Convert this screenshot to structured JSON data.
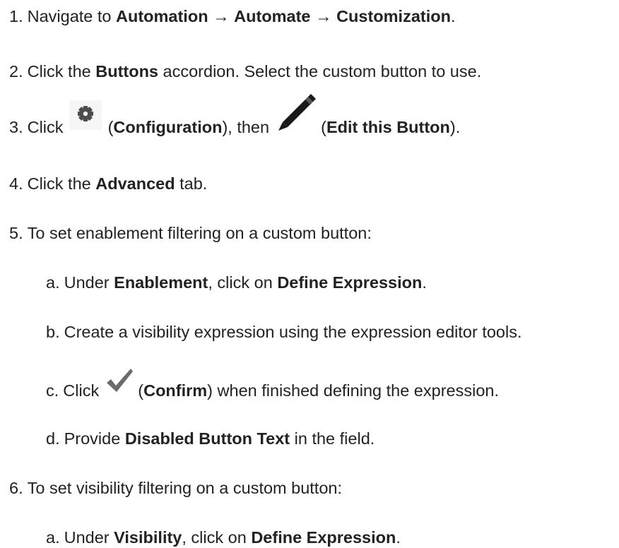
{
  "steps": [
    {
      "num": "1.",
      "t1": "Navigate to ",
      "b1": "Automation",
      "t2": " → ",
      "b2": "Automate",
      "t3": " → ",
      "b3": "Customization",
      "t4": "."
    },
    {
      "num": "2.",
      "t1": "Click the ",
      "b1": "Buttons",
      "t2": " accordion. Select the custom button to use."
    },
    {
      "num": "3.",
      "t1": "Click ",
      "icon1": "gear-icon",
      "t2": " (",
      "b1": "Configuration",
      "t3": "), then ",
      "icon2": "pencil-icon",
      "t4": " (",
      "b2": "Edit this Button",
      "t5": ")."
    },
    {
      "num": "4.",
      "t1": "Click the ",
      "b1": "Advanced",
      "t2": " tab."
    },
    {
      "num": "5.",
      "t1": "To set enablement filtering on a custom button:",
      "substeps": [
        {
          "letter": "a.",
          "t1": "Under ",
          "b1": "Enablement",
          "t2": ", click on ",
          "b2": "Define Expression",
          "t3": "."
        },
        {
          "letter": "b.",
          "t1": "Create a visibility expression using the expression editor tools."
        },
        {
          "letter": "c.",
          "t1": "Click ",
          "icon1": "checkmark-icon",
          "t2": " (",
          "b1": "Confirm",
          "t3": ") when finished defining the expression."
        },
        {
          "letter": "d.",
          "t1": "Provide ",
          "b1": "Disabled Button Text",
          "t2": " in the field."
        }
      ]
    },
    {
      "num": "6.",
      "t1": "To set visibility filtering on a custom button:",
      "substeps": [
        {
          "letter": "a.",
          "t1": "Under ",
          "b1": "Visibility",
          "t2": ", click on ",
          "b2": "Define Expression",
          "t3": "."
        }
      ]
    }
  ]
}
